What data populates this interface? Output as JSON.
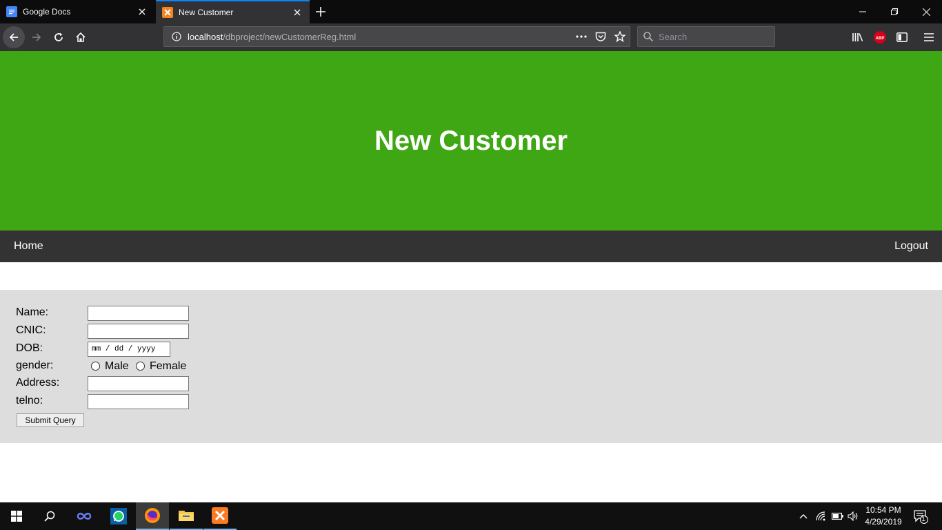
{
  "browser": {
    "tabs": [
      {
        "label": "Google Docs",
        "active": false
      },
      {
        "label": "New Customer",
        "active": true
      }
    ],
    "url_host": "localhost",
    "url_path": "/dbproject/newCustomerReg.html",
    "search_placeholder": "Search",
    "accent_color": "#0a84ff",
    "abp_label": "ABP"
  },
  "page": {
    "banner_title": "New Customer",
    "banner_color": "#3fa614",
    "nav": {
      "home": "Home",
      "logout": "Logout"
    },
    "form": {
      "name_label": "Name:",
      "cnic_label": "CNIC:",
      "dob_label": "DOB:",
      "dob_placeholder": "mm / dd / yyyy",
      "gender_label": "gender:",
      "gender_options": [
        "Male",
        "Female"
      ],
      "address_label": "Address:",
      "telno_label": "telno:",
      "submit_label": "Submit Query"
    }
  },
  "taskbar": {
    "time": "10:54 PM",
    "date": "4/29/2019",
    "notification_count": "1"
  }
}
